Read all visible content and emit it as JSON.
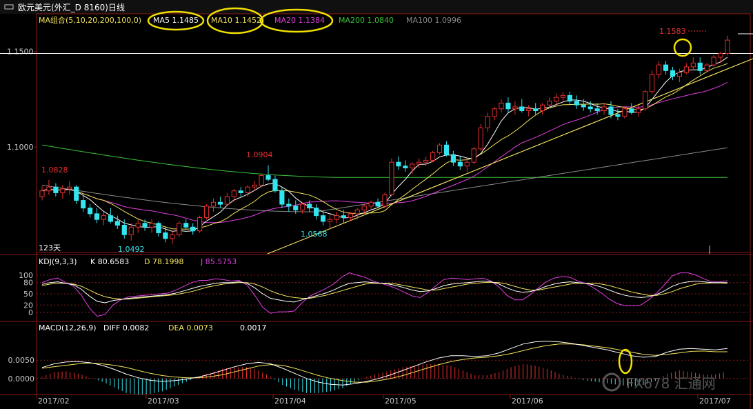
{
  "window": {
    "title_icon": "pair-icon",
    "title": "欧元美元(外汇_D 8160)日线"
  },
  "colors": {
    "background": "#000000",
    "frame": "#8b1a1a",
    "up": "#e8312f",
    "down": "#33e5ee",
    "ma5": "#ffffff",
    "ma10": "#f5e65a",
    "ma20": "#e040e0",
    "ma200": "#3bc43b",
    "ma100": "#8a8a8a",
    "trendline": "#f0e060",
    "annotation": "#f2e000",
    "k": "#ffffff",
    "d": "#f5e65a",
    "j": "#e040e0",
    "macd_pos": "#e8312f",
    "macd_neg": "#33e5ee",
    "diff": "#ffffff",
    "dea": "#f5e65a",
    "axis_text": "#c8c8c8",
    "price_label_high": "#e8312f",
    "price_label_low": "#33e5ee"
  },
  "legend": {
    "group": {
      "text": "MA组合(5,10,20,200,100,0)",
      "color": "#f5e65a"
    },
    "ma5": {
      "text": "MA5 1.1485",
      "color": "#ffffff"
    },
    "ma10": {
      "text": "MA10 1.1452",
      "color": "#f5e65a"
    },
    "ma20": {
      "text": "MA20 1.1384",
      "color": "#e040e0"
    },
    "ma200": {
      "text": "MA200 1.0840",
      "color": "#3bc43b"
    },
    "ma100": {
      "text": "MA100 1.0996",
      "color": "#8a8a8a"
    }
  },
  "kdj_legend": {
    "name": "KDJ(9,3,3)",
    "k": "K  80.6583",
    "d": "D  78.1998",
    "j": "J  85.5753"
  },
  "macd_legend": {
    "name": "MACD(12,26,9)",
    "diff": "DIFF  0.0082",
    "dea": "DEA  0.0073",
    "macd": "0.0017"
  },
  "labels": {
    "high_start": "1.0828",
    "low_mar": "1.0492",
    "high_apr": "1.0904",
    "low_apr": "1.0568",
    "last_high": "1.1583",
    "days": "123天",
    "watermark": "FX678 汇通网"
  },
  "chart_data": [
    {
      "type": "candlestick",
      "title": "欧元美元(外汇_D 8160)日线",
      "ylim": [
        1.044,
        1.164
      ],
      "yticks": [
        "1.1500",
        "1.1000"
      ],
      "xticks": [
        "2017/02",
        "2017/03",
        "2017/04",
        "2017/05",
        "2017/06",
        "2017/07"
      ],
      "x_range": [
        "2017-02-01",
        "2017-07-06"
      ],
      "reference_line": 1.149,
      "ohlc": [
        [
          1.074,
          1.0795,
          1.072,
          1.077
        ],
        [
          1.077,
          1.0828,
          1.075,
          1.079
        ],
        [
          1.079,
          1.081,
          1.074,
          1.076
        ],
        [
          1.076,
          1.08,
          1.073,
          1.078
        ],
        [
          1.078,
          1.082,
          1.075,
          1.079
        ],
        [
          1.079,
          1.08,
          1.07,
          1.072
        ],
        [
          1.072,
          1.075,
          1.066,
          1.068
        ],
        [
          1.068,
          1.07,
          1.063,
          1.065
        ],
        [
          1.065,
          1.068,
          1.06,
          1.062
        ],
        [
          1.062,
          1.066,
          1.059,
          1.064
        ],
        [
          1.064,
          1.068,
          1.06,
          1.061
        ],
        [
          1.061,
          1.064,
          1.057,
          1.059
        ],
        [
          1.059,
          1.062,
          1.052,
          1.054
        ],
        [
          1.054,
          1.06,
          1.051,
          1.058
        ],
        [
          1.058,
          1.062,
          1.055,
          1.06
        ],
        [
          1.06,
          1.062,
          1.056,
          1.058
        ],
        [
          1.058,
          1.062,
          1.055,
          1.06
        ],
        [
          1.06,
          1.061,
          1.053,
          1.055
        ],
        [
          1.055,
          1.058,
          1.05,
          1.052
        ],
        [
          1.052,
          1.056,
          1.0492,
          1.054
        ],
        [
          1.054,
          1.061,
          1.053,
          1.06
        ],
        [
          1.06,
          1.062,
          1.057,
          1.058
        ],
        [
          1.058,
          1.06,
          1.054,
          1.056
        ],
        [
          1.056,
          1.064,
          1.055,
          1.063
        ],
        [
          1.063,
          1.07,
          1.062,
          1.069
        ],
        [
          1.069,
          1.073,
          1.066,
          1.071
        ],
        [
          1.071,
          1.074,
          1.068,
          1.07
        ],
        [
          1.07,
          1.076,
          1.069,
          1.074
        ],
        [
          1.074,
          1.078,
          1.071,
          1.077
        ],
        [
          1.077,
          1.079,
          1.074,
          1.076
        ],
        [
          1.076,
          1.08,
          1.074,
          1.079
        ],
        [
          1.079,
          1.082,
          1.077,
          1.08
        ],
        [
          1.08,
          1.086,
          1.079,
          1.085
        ],
        [
          1.085,
          1.0904,
          1.082,
          1.083
        ],
        [
          1.083,
          1.085,
          1.076,
          1.077
        ],
        [
          1.077,
          1.079,
          1.068,
          1.07
        ],
        [
          1.07,
          1.073,
          1.066,
          1.069
        ],
        [
          1.069,
          1.072,
          1.065,
          1.067
        ],
        [
          1.067,
          1.071,
          1.065,
          1.07
        ],
        [
          1.07,
          1.072,
          1.066,
          1.068
        ],
        [
          1.068,
          1.07,
          1.062,
          1.064
        ],
        [
          1.064,
          1.066,
          1.059,
          1.061
        ],
        [
          1.061,
          1.065,
          1.0568,
          1.062
        ],
        [
          1.062,
          1.066,
          1.06,
          1.064
        ],
        [
          1.064,
          1.067,
          1.06,
          1.063
        ],
        [
          1.063,
          1.066,
          1.061,
          1.065
        ],
        [
          1.065,
          1.068,
          1.062,
          1.067
        ],
        [
          1.067,
          1.07,
          1.065,
          1.069
        ],
        [
          1.069,
          1.072,
          1.067,
          1.071
        ],
        [
          1.071,
          1.073,
          1.068,
          1.069
        ],
        [
          1.069,
          1.076,
          1.068,
          1.075
        ],
        [
          1.075,
          1.094,
          1.074,
          1.092
        ],
        [
          1.092,
          1.095,
          1.088,
          1.09
        ],
        [
          1.09,
          1.093,
          1.087,
          1.089
        ],
        [
          1.089,
          1.092,
          1.086,
          1.091
        ],
        [
          1.091,
          1.094,
          1.089,
          1.092
        ],
        [
          1.092,
          1.095,
          1.09,
          1.093
        ],
        [
          1.093,
          1.098,
          1.092,
          1.097
        ],
        [
          1.097,
          1.102,
          1.096,
          1.101
        ],
        [
          1.101,
          1.103,
          1.095,
          1.096
        ],
        [
          1.096,
          1.098,
          1.09,
          1.092
        ],
        [
          1.092,
          1.095,
          1.088,
          1.09
        ],
        [
          1.09,
          1.094,
          1.087,
          1.092
        ],
        [
          1.092,
          1.1,
          1.091,
          1.099
        ],
        [
          1.099,
          1.112,
          1.098,
          1.11
        ],
        [
          1.11,
          1.118,
          1.108,
          1.116
        ],
        [
          1.116,
          1.121,
          1.114,
          1.12
        ],
        [
          1.12,
          1.125,
          1.118,
          1.123
        ],
        [
          1.123,
          1.126,
          1.118,
          1.12
        ],
        [
          1.12,
          1.124,
          1.117,
          1.121
        ],
        [
          1.121,
          1.125,
          1.118,
          1.119
        ],
        [
          1.119,
          1.122,
          1.116,
          1.12
        ],
        [
          1.12,
          1.123,
          1.117,
          1.119
        ],
        [
          1.119,
          1.123,
          1.117,
          1.122
        ],
        [
          1.122,
          1.126,
          1.12,
          1.124
        ],
        [
          1.124,
          1.128,
          1.122,
          1.126
        ],
        [
          1.126,
          1.129,
          1.123,
          1.127
        ],
        [
          1.127,
          1.129,
          1.122,
          1.124
        ],
        [
          1.124,
          1.127,
          1.12,
          1.122
        ],
        [
          1.122,
          1.125,
          1.119,
          1.121
        ],
        [
          1.121,
          1.124,
          1.118,
          1.12
        ],
        [
          1.12,
          1.123,
          1.117,
          1.119
        ],
        [
          1.119,
          1.123,
          1.117,
          1.121
        ],
        [
          1.121,
          1.124,
          1.115,
          1.117
        ],
        [
          1.117,
          1.12,
          1.114,
          1.116
        ],
        [
          1.116,
          1.121,
          1.115,
          1.12
        ],
        [
          1.12,
          1.123,
          1.117,
          1.118
        ],
        [
          1.118,
          1.122,
          1.116,
          1.12
        ],
        [
          1.12,
          1.13,
          1.119,
          1.129
        ],
        [
          1.129,
          1.14,
          1.128,
          1.138
        ],
        [
          1.138,
          1.145,
          1.136,
          1.143
        ],
        [
          1.143,
          1.145,
          1.138,
          1.14
        ],
        [
          1.14,
          1.142,
          1.135,
          1.137
        ],
        [
          1.137,
          1.141,
          1.134,
          1.139
        ],
        [
          1.139,
          1.144,
          1.138,
          1.142
        ],
        [
          1.142,
          1.147,
          1.14,
          1.144
        ],
        [
          1.144,
          1.147,
          1.138,
          1.14
        ],
        [
          1.14,
          1.144,
          1.139,
          1.143
        ],
        [
          1.143,
          1.148,
          1.142,
          1.147
        ],
        [
          1.147,
          1.15,
          1.144,
          1.149
        ],
        [
          1.149,
          1.1583,
          1.148,
          1.156
        ]
      ]
    },
    {
      "type": "line",
      "title": "KDJ(9,3,3)",
      "ylim": [
        -20,
        120
      ],
      "yticks": [
        "100",
        "80",
        "50",
        "20",
        "0"
      ],
      "series": [
        {
          "name": "K",
          "values": [
            75,
            80,
            82,
            78,
            74,
            62,
            44,
            30,
            26,
            32,
            35,
            38,
            40,
            42,
            44,
            46,
            48,
            52,
            58,
            64,
            70,
            74,
            78,
            80,
            80,
            82,
            78,
            66,
            50,
            38,
            34,
            30,
            28,
            34,
            40,
            46,
            52,
            60,
            70,
            78,
            80,
            82,
            80,
            78,
            76,
            72,
            66,
            60,
            56,
            58,
            64,
            72,
            76,
            78,
            80,
            82,
            84,
            82,
            76,
            66,
            58,
            54,
            56,
            62,
            70,
            76,
            80,
            82,
            80,
            78,
            74,
            68,
            60,
            52,
            46,
            42,
            40,
            42,
            48,
            58,
            70,
            78,
            82,
            84,
            82,
            80,
            80,
            80
          ]
        },
        {
          "name": "D",
          "values": [
            72,
            76,
            78,
            78,
            76,
            70,
            60,
            50,
            42,
            38,
            36,
            36,
            38,
            40,
            42,
            44,
            46,
            48,
            52,
            56,
            62,
            68,
            72,
            76,
            78,
            80,
            80,
            76,
            68,
            58,
            50,
            44,
            40,
            38,
            38,
            42,
            46,
            52,
            58,
            64,
            70,
            76,
            78,
            78,
            78,
            76,
            72,
            68,
            64,
            60,
            60,
            64,
            68,
            72,
            76,
            78,
            80,
            81,
            80,
            76,
            70,
            64,
            60,
            60,
            64,
            68,
            72,
            76,
            78,
            78,
            78,
            76,
            72,
            66,
            60,
            54,
            50,
            46,
            46,
            50,
            56,
            64,
            70,
            76,
            78,
            79,
            79,
            78
          ]
        },
        {
          "name": "J",
          "values": [
            80,
            88,
            92,
            80,
            70,
            46,
            12,
            -10,
            -5,
            20,
            34,
            42,
            44,
            46,
            48,
            50,
            52,
            60,
            70,
            80,
            86,
            86,
            90,
            88,
            84,
            86,
            74,
            46,
            14,
            -2,
            2,
            2,
            4,
            26,
            44,
            54,
            64,
            76,
            94,
            106,
            100,
            94,
            84,
            78,
            72,
            64,
            54,
            44,
            40,
            54,
            72,
            88,
            92,
            90,
            88,
            90,
            92,
            84,
            68,
            46,
            34,
            34,
            48,
            66,
            82,
            92,
            96,
            94,
            84,
            78,
            66,
            52,
            36,
            24,
            18,
            18,
            20,
            34,
            52,
            74,
            98,
            106,
            106,
            100,
            90,
            82,
            82,
            85
          ]
        }
      ]
    },
    {
      "type": "bar",
      "title": "MACD(12,26,9)",
      "ylim": [
        -0.004,
        0.012
      ],
      "yticks": [
        "0.0050",
        "0.0000"
      ],
      "series": [
        {
          "name": "DIFF",
          "values": [
            0.003,
            0.004,
            0.0045,
            0.0046,
            0.0043,
            0.0036,
            0.0025,
            0.0012,
            0.0002,
            -0.0005,
            -0.0008,
            -0.0006,
            -0.0002,
            0.0004,
            0.0012,
            0.0022,
            0.0032,
            0.004,
            0.0044,
            0.004,
            0.0028,
            0.0014,
            0.0,
            -0.001,
            -0.0016,
            -0.0018,
            -0.0014,
            -0.0008,
            0.0,
            0.001,
            0.0022,
            0.0034,
            0.0046,
            0.0056,
            0.0062,
            0.0062,
            0.006,
            0.0062,
            0.007,
            0.0082,
            0.0094,
            0.01,
            0.0102,
            0.01,
            0.0096,
            0.009,
            0.0084,
            0.0078,
            0.007,
            0.0062,
            0.0058,
            0.006,
            0.0072,
            0.008,
            0.0082,
            0.008,
            0.0078,
            0.0082
          ]
        },
        {
          "name": "DEA",
          "values": [
            0.0028,
            0.0032,
            0.0036,
            0.004,
            0.0042,
            0.004,
            0.0036,
            0.003,
            0.0022,
            0.0014,
            0.0008,
            0.0004,
            0.0002,
            0.0002,
            0.0005,
            0.001,
            0.0018,
            0.0026,
            0.0034,
            0.0038,
            0.0036,
            0.0028,
            0.0018,
            0.0008,
            0.0,
            -0.0006,
            -0.001,
            -0.001,
            -0.0006,
            0.0,
            0.0008,
            0.0018,
            0.0028,
            0.0038,
            0.0046,
            0.0052,
            0.0056,
            0.0058,
            0.0062,
            0.0068,
            0.0076,
            0.0084,
            0.009,
            0.0094,
            0.0094,
            0.0092,
            0.0088,
            0.0084,
            0.0078,
            0.0072,
            0.0066,
            0.0063,
            0.0066,
            0.007,
            0.0074,
            0.0075,
            0.0073,
            0.0073
          ]
        }
      ]
    }
  ]
}
